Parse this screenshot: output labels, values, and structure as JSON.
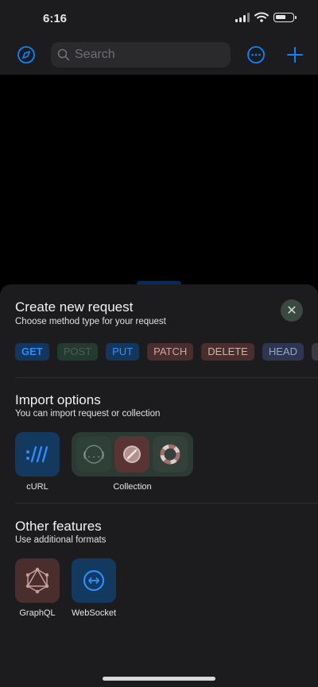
{
  "status_bar": {
    "time": "6:16"
  },
  "toolbar": {
    "search_placeholder": "Search"
  },
  "sheet": {
    "create": {
      "title": "Create new request",
      "subtitle": "Choose method type for your request"
    },
    "methods": [
      {
        "label": "GET",
        "bg": "#12365c",
        "fg": "#2e8bff"
      },
      {
        "label": "POST",
        "bg": "#233a31",
        "fg": "#4c5f55"
      },
      {
        "label": "PUT",
        "bg": "#12365c",
        "fg": "#3b8ff5"
      },
      {
        "label": "PATCH",
        "bg": "#4a2e2e",
        "fg": "#c9a7a4"
      },
      {
        "label": "DELETE",
        "bg": "#4a2e2e",
        "fg": "#d0b1ae"
      },
      {
        "label": "HEAD",
        "bg": "#2e3550",
        "fg": "#9aa4c4"
      },
      {
        "label": "OP",
        "bg": "#3a3a3e",
        "fg": "#bdbdc2"
      }
    ],
    "import": {
      "title": "Import options",
      "subtitle": "You can import request or collection",
      "curl_label": "cURL",
      "collection_label": "Collection"
    },
    "other": {
      "title": "Other features",
      "subtitle": "Use additional formats",
      "graphql_label": "GraphQL",
      "websocket_label": "WebSocket"
    }
  },
  "icons": {
    "app": "compass-icon",
    "more": "ellipsis-circle-icon",
    "add": "plus-icon",
    "close": "close-icon",
    "curl": "curl-icon",
    "collection": [
      "braces-icon",
      "compass-icon",
      "lifebuoy-icon"
    ],
    "graphql": "graphql-icon",
    "websocket": "websocket-icon"
  },
  "colors": {
    "accent": "#0a84ff",
    "sheet": "#1c1c1e"
  }
}
